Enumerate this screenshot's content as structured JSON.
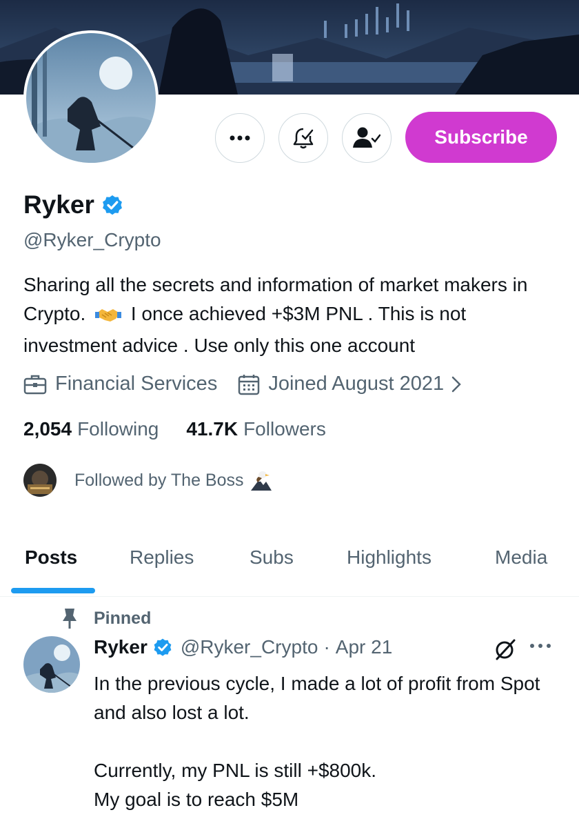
{
  "profile": {
    "name": "Ryker",
    "handle": "@Ryker_Crypto",
    "bio_part1": "Sharing all the secrets and information of market makers in Crypto.",
    "bio_emoji": "handshake",
    "bio_part2": "I once achieved +$3M PNL . This is not investment advice . Use only this one account",
    "category": "Financial Services",
    "joined": "Joined August 2021",
    "following_count": "2,054",
    "following_label": "Following",
    "followers_count": "41.7K",
    "followers_label": "Followers",
    "followed_by": "Followed by The Boss",
    "followed_by_emoji": "eagle-mountain"
  },
  "actions": {
    "more_icon": "more-horizontal-icon",
    "notify_icon": "bell-check-icon",
    "follow_icon": "user-check-icon",
    "subscribe_label": "Subscribe"
  },
  "tabs": [
    {
      "label": "Posts",
      "active": true
    },
    {
      "label": "Replies",
      "active": false
    },
    {
      "label": "Subs",
      "active": false
    },
    {
      "label": "Highlights",
      "active": false
    },
    {
      "label": "Media",
      "active": false
    }
  ],
  "pinned_post": {
    "pinned_label": "Pinned",
    "author_name": "Ryker",
    "author_handle": "@Ryker_Crypto",
    "separator": "·",
    "date": "Apr 21",
    "text": "In the previous cycle, I made a lot of profit from Spot and also lost a lot.\n\nCurrently, my PNL is still +$800k.\nMy goal is to reach $5M"
  },
  "colors": {
    "accent": "#1d9bf0",
    "subscribe": "#d03ad0",
    "muted_text": "#536471",
    "primary_text": "#0f1419",
    "border": "#cfd9de"
  }
}
